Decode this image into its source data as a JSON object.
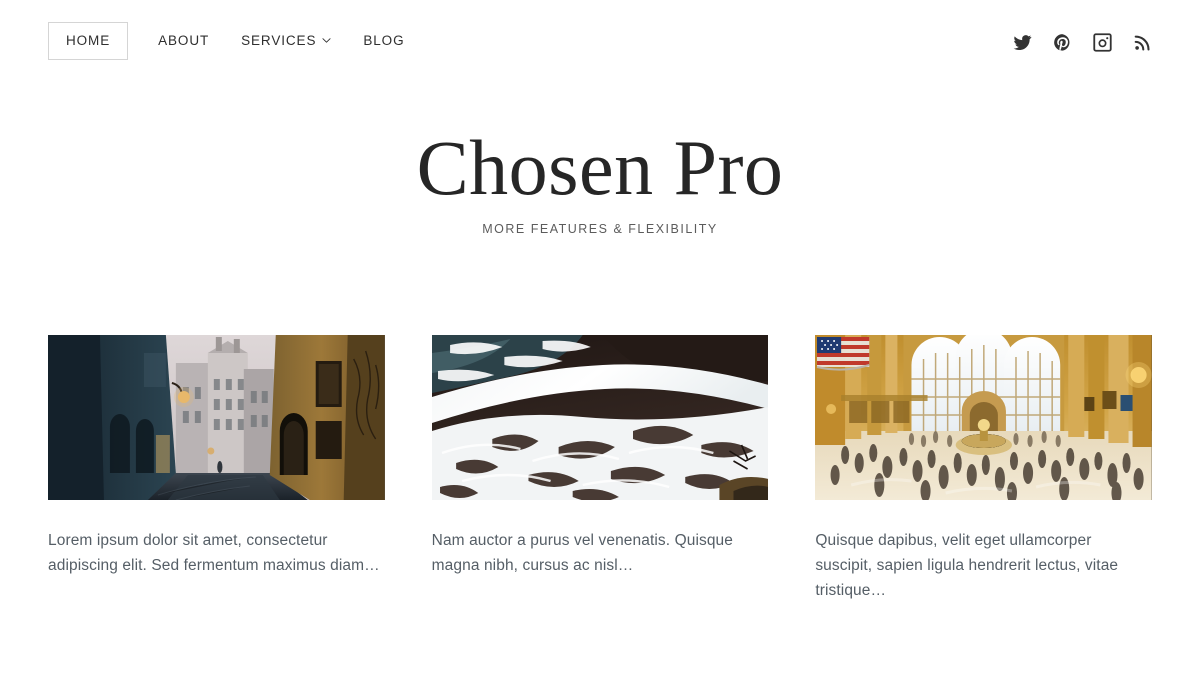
{
  "header": {
    "nav": [
      {
        "label": "HOME",
        "current": true,
        "has_dropdown": false
      },
      {
        "label": "ABOUT",
        "current": false,
        "has_dropdown": false
      },
      {
        "label": "SERVICES",
        "current": false,
        "has_dropdown": true
      },
      {
        "label": "BLOG",
        "current": false,
        "has_dropdown": false
      }
    ],
    "social": [
      {
        "name": "twitter",
        "title": "Twitter"
      },
      {
        "name": "pinterest",
        "title": "Pinterest"
      },
      {
        "name": "instagram",
        "title": "Instagram"
      },
      {
        "name": "rss",
        "title": "RSS"
      }
    ]
  },
  "hero": {
    "title": "Chosen Pro",
    "tagline": "MORE FEATURES & FLEXIBILITY"
  },
  "posts": [
    {
      "image_alt": "Narrow European cobblestone street at dusk with golden building on the right",
      "excerpt": "Lorem ipsum dolor sit amet, consectetur adipiscing elit. Sed fermentum maximus diam…"
    },
    {
      "image_alt": "Aerial view of white ocean surf crashing over dark rocks",
      "excerpt": "Nam auctor a purus vel venenatis. Quisque magna nibh, cursus ac nisl…"
    },
    {
      "image_alt": "Grand Central Terminal interior with American flag and blurred crowds",
      "excerpt": "Quisque dapibus, velit eget ullamcorper suscipit, sapien ligula hendrerit lectus, vitae tristique…"
    }
  ],
  "colors": {
    "page_background": "#ffffff",
    "nav_text": "#2f2f2f",
    "nav_current_border": "#d5d5d5",
    "title_text": "#262626",
    "tagline_text": "#5c5c5c",
    "excerpt_text": "#555e66",
    "icon": "#333333"
  }
}
